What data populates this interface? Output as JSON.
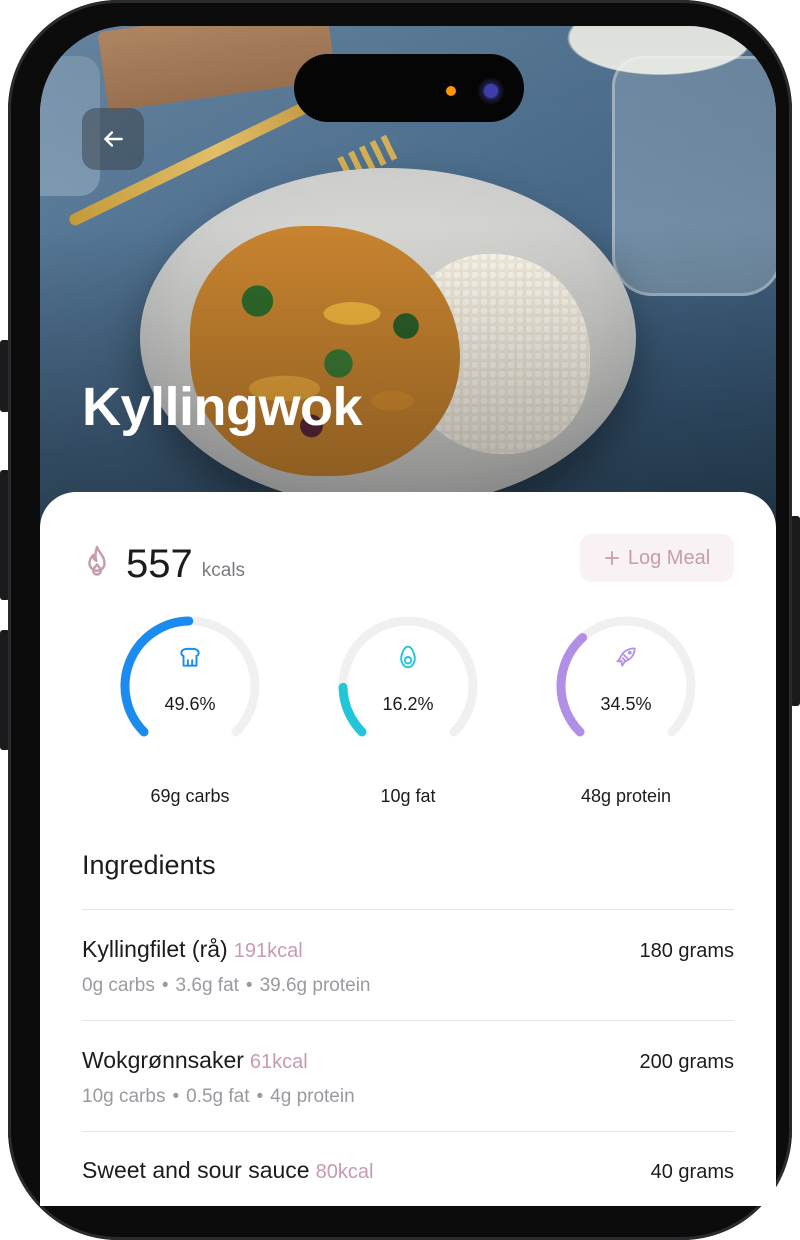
{
  "recipe": {
    "title": "Kyllingwok"
  },
  "nutrition": {
    "kcal_value": "557",
    "kcal_unit": "kcals",
    "log_meal_label": "Log Meal",
    "macros": [
      {
        "name": "carbs",
        "percent_label": "49.6%",
        "percent": 49.6,
        "amount_label": "69g carbs",
        "color": "#1a8cf0",
        "icon": "bread-icon"
      },
      {
        "name": "fat",
        "percent_label": "16.2%",
        "percent": 16.2,
        "amount_label": "10g fat",
        "color": "#22c6d8",
        "icon": "avocado-icon"
      },
      {
        "name": "protein",
        "percent_label": "34.5%",
        "percent": 34.5,
        "amount_label": "48g protein",
        "color": "#b18fe6",
        "icon": "fish-icon"
      }
    ]
  },
  "ingredients": {
    "title": "Ingredients",
    "items": [
      {
        "name": "Kyllingfilet (rå)",
        "kcal": "191kcal",
        "amount": "180 grams",
        "carbs": "0g carbs",
        "fat": "3.6g fat",
        "protein": "39.6g protein"
      },
      {
        "name": "Wokgrønnsaker",
        "kcal": "61kcal",
        "amount": "200 grams",
        "carbs": "10g carbs",
        "fat": "0.5g fat",
        "protein": "4g protein"
      },
      {
        "name": "Sweet and sour sauce",
        "kcal": "80kcal",
        "amount": "40 grams",
        "carbs": "",
        "fat": "",
        "protein": ""
      }
    ]
  },
  "colors": {
    "accent_pink": "#c79bb0",
    "log_button_bg": "#f8f2f4",
    "track": "#f0f0f1"
  }
}
